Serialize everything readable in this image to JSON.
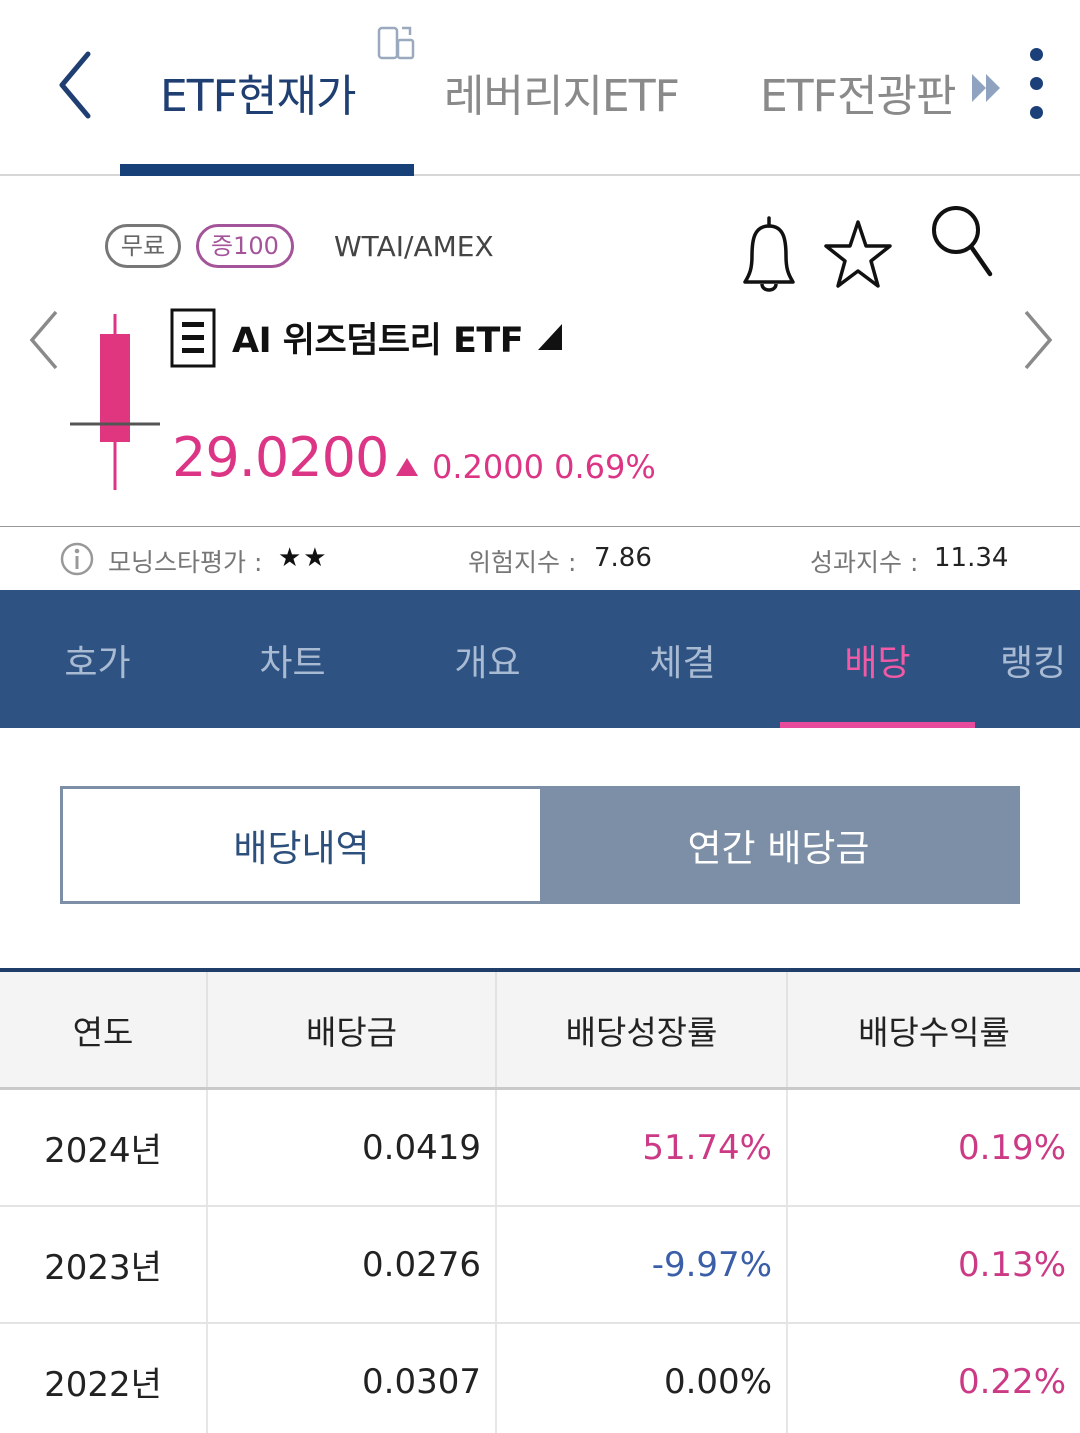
{
  "top_tabs": [
    {
      "label": "ETF현재가",
      "active": true
    },
    {
      "label": "레버리지ETF",
      "active": false
    },
    {
      "label": "ETF전광판",
      "active": false
    }
  ],
  "stock": {
    "badge_free": "무료",
    "badge_margin": "증100",
    "ticker": "WTAI/AMEX",
    "name": "AI 위즈덤트리 ETF",
    "price": "29.0200",
    "change": "0.2000",
    "change_pct": "0.69%"
  },
  "ratings": {
    "morningstar_label": "모닝스타평가 :",
    "morningstar_stars": "★★",
    "risk_label": "위험지수 :",
    "risk_value": "7.86",
    "perf_label": "성과지수 :",
    "perf_value": "11.34"
  },
  "section_tabs": [
    {
      "label": "호가",
      "active": false
    },
    {
      "label": "차트",
      "active": false
    },
    {
      "label": "개요",
      "active": false
    },
    {
      "label": "체결",
      "active": false
    },
    {
      "label": "배당",
      "active": true
    },
    {
      "label": "랭킹",
      "active": false
    }
  ],
  "segment": {
    "history": "배당내역",
    "annual": "연간 배당금",
    "selected": "history"
  },
  "table": {
    "headers": [
      "연도",
      "배당금",
      "배당성장률",
      "배당수익률"
    ],
    "rows": [
      {
        "year": "2024년",
        "dividend": "0.0419",
        "growth": "51.74%",
        "yield": "0.19%"
      },
      {
        "year": "2023년",
        "dividend": "0.0276",
        "growth": "-9.97%",
        "yield": "0.13%"
      },
      {
        "year": "2022년",
        "dividend": "0.0307",
        "growth": "0.00%",
        "yield": "0.22%"
      }
    ]
  },
  "colors": {
    "navy": "#1f3f73",
    "tab_bar": "#2e5282",
    "up_pink": "#dc3585",
    "down_blue": "#3a5ea8"
  },
  "icons": [
    "back-chevron-icon",
    "device-switch-icon",
    "fast-forward-icon",
    "more-vertical-icon",
    "bell-icon",
    "star-icon",
    "search-icon",
    "chevron-left-icon",
    "chevron-right-icon",
    "candlestick-icon",
    "document-icon",
    "dropdown-triangle-icon",
    "up-triangle-icon",
    "info-icon"
  ]
}
